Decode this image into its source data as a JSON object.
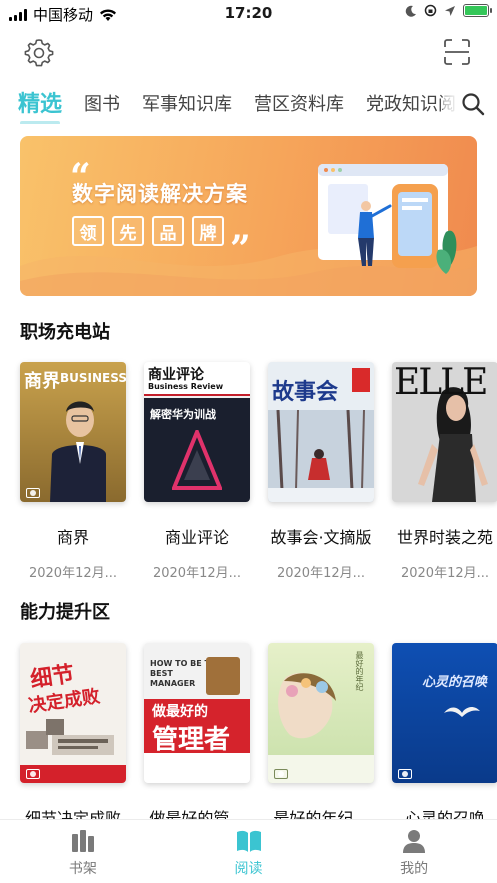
{
  "status_bar": {
    "carrier": "中国移动",
    "time": "17:20"
  },
  "header": {
    "settings_icon": "gear-icon",
    "scan_icon": "scan-icon"
  },
  "tabs": [
    {
      "label": "精选",
      "active": true
    },
    {
      "label": "图书",
      "active": false
    },
    {
      "label": "军事知识库",
      "active": false
    },
    {
      "label": "营区资料库",
      "active": false
    },
    {
      "label": "党政知识阅",
      "active": false
    }
  ],
  "banner": {
    "title": "数字阅读解决方案",
    "chips": [
      "领",
      "先",
      "品",
      "牌"
    ]
  },
  "sections": [
    {
      "title": "职场充电站",
      "books": [
        {
          "title": "商界",
          "date": "2020年12月...",
          "cover_masthead": "商界",
          "cover_sub": "BUSINESS"
        },
        {
          "title": "商业评论",
          "date": "2020年12月...",
          "cover_masthead": "商业评论",
          "cover_sub": "Business Review",
          "cover_headline": "解密华为训战"
        },
        {
          "title": "故事会·文摘版",
          "date": "2020年12月...",
          "cover_masthead": "故事会"
        },
        {
          "title": "世界时装之苑",
          "date": "2020年12月...",
          "cover_masthead": "ELLE"
        }
      ]
    },
    {
      "title": "能力提升区",
      "books": [
        {
          "title": "细节决定成败",
          "cover_line1": "细节",
          "cover_line2": "决定成败"
        },
        {
          "title": "做最好的管...",
          "cover_line1": "做最好的",
          "cover_line2": "管理者"
        },
        {
          "title": "最好的年纪..."
        },
        {
          "title": "心灵的召唤",
          "cover_line1": "心灵的召唤"
        }
      ]
    }
  ],
  "bottom_nav": [
    {
      "label": "书架",
      "icon": "bookshelf-icon",
      "active": false
    },
    {
      "label": "阅读",
      "icon": "open-book-icon",
      "active": true
    },
    {
      "label": "我的",
      "icon": "person-icon",
      "active": false
    }
  ],
  "colors": {
    "accent": "#3bc4d1",
    "banner_start": "#f9c26a",
    "banner_end": "#f08a4e"
  }
}
